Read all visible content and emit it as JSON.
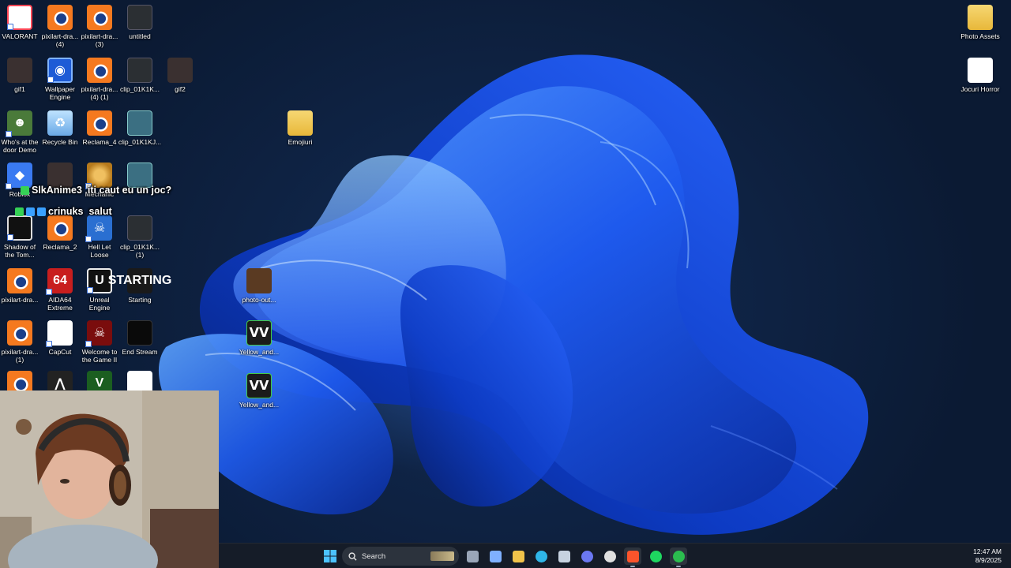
{
  "desktop": {
    "icons_left": [
      {
        "label": "VALORANT",
        "kind": "valorant",
        "glyph": "V"
      },
      {
        "label": "pixilart-dra...\n(4)",
        "kind": "blender",
        "glyph": ""
      },
      {
        "label": "pixilart-dra...\n(3)",
        "kind": "blender",
        "glyph": ""
      },
      {
        "label": "untitled",
        "kind": "dark",
        "glyph": ""
      },
      {
        "label": "gif1",
        "kind": "thumb",
        "glyph": ""
      },
      {
        "label": "Wallpaper\nEngine",
        "kind": "wallpaper",
        "glyph": "◉"
      },
      {
        "label": "pixilart-dra...\n(4) (1)",
        "kind": "blender",
        "glyph": ""
      },
      {
        "label": "clip_01K1K...",
        "kind": "dark",
        "glyph": ""
      },
      {
        "label": "gif2",
        "kind": "thumb",
        "glyph": ""
      },
      {
        "label": "Who's at the\ndoor Demo",
        "kind": "who",
        "glyph": "☻"
      },
      {
        "label": "Recycle Bin",
        "kind": "recycle",
        "glyph": "♻"
      },
      {
        "label": "Reclama_4",
        "kind": "blender",
        "glyph": ""
      },
      {
        "label": "clip_01K1KJ...",
        "kind": "clip",
        "glyph": ""
      },
      {
        "label": "Roblox",
        "kind": "roblox",
        "glyph": "◆"
      },
      {
        "label": "",
        "kind": "thumb",
        "glyph": ""
      },
      {
        "label": "Mechanic",
        "kind": "mech",
        "glyph": ""
      },
      {
        "label": "",
        "kind": "clip",
        "glyph": ""
      },
      {
        "label": "Shadow of\nthe Tom...",
        "kind": "shadow",
        "glyph": ""
      },
      {
        "label": "Reclama_2",
        "kind": "blender",
        "glyph": ""
      },
      {
        "label": "Hell Let\nLoose",
        "kind": "hell",
        "glyph": "☠"
      },
      {
        "label": "clip_01K1K...\n(1)",
        "kind": "dark",
        "glyph": ""
      },
      {
        "label": "pixilart-dra...",
        "kind": "blender",
        "glyph": ""
      },
      {
        "label": "AIDA64\nExtreme",
        "kind": "aida",
        "glyph": "64"
      },
      {
        "label": "Unreal\nEngine",
        "kind": "unreal",
        "glyph": "U"
      },
      {
        "label": "Starting",
        "kind": "starting",
        "glyph": "STARTING"
      },
      {
        "label": "pixilart-dra...\n(1)",
        "kind": "blender",
        "glyph": ""
      },
      {
        "label": "CapCut",
        "kind": "capcut",
        "glyph": "✂"
      },
      {
        "label": "Welcome to\nthe Game II",
        "kind": "skull",
        "glyph": "☠"
      },
      {
        "label": "End Stream",
        "kind": "endstream",
        "glyph": ""
      },
      {
        "label": "",
        "kind": "blender",
        "glyph": ""
      },
      {
        "label": "",
        "kind": "ac",
        "glyph": "⋀"
      },
      {
        "label": "",
        "kind": "gta",
        "glyph": "V"
      },
      {
        "label": "",
        "kind": "xbox",
        "glyph": "✕"
      }
    ],
    "icons_middle": [
      {
        "label": "Emojiuri",
        "kind": "folder",
        "glyph": ""
      },
      {
        "label": "photo-out...",
        "kind": "photo",
        "glyph": ""
      },
      {
        "label": "Yellow_and...",
        "kind": "yellow",
        "glyph": "ᐯᐯ"
      },
      {
        "label": "Yellow_and...",
        "kind": "yellow",
        "glyph": "ᐯᐯ"
      }
    ],
    "icons_right": [
      {
        "label": "Photo Assets",
        "kind": "folder",
        "glyph": ""
      },
      {
        "label": "Jocuri Horror",
        "kind": "doc",
        "glyph": ""
      }
    ]
  },
  "chat": [
    {
      "user": "SlkAnime3",
      "message": "iti caut eu un joc?",
      "user_color": "#ffffff",
      "badges": [
        "#36d156"
      ]
    },
    {
      "user": "crinuks",
      "message": "salut",
      "user_color": "#ffffff",
      "badges": [
        "#36d156",
        "#3aa0ff",
        "#3aa0ff"
      ]
    }
  ],
  "taskbar": {
    "search_placeholder": "Search",
    "pinned": [
      {
        "name": "task-view-icon",
        "color": "#9aa6b8"
      },
      {
        "name": "copilot-icon",
        "color": "#7fb0ff"
      },
      {
        "name": "file-explorer-icon",
        "color": "#f0c34a"
      },
      {
        "name": "edge-icon",
        "color": "#2fb6e8"
      },
      {
        "name": "store-icon",
        "color": "#c7d2e0"
      },
      {
        "name": "discord-icon",
        "color": "#6b78f2"
      },
      {
        "name": "obs-icon",
        "color": "#e0e0e0"
      },
      {
        "name": "brave-icon",
        "color": "#fb542b"
      },
      {
        "name": "spotify-icon",
        "color": "#1ed760"
      },
      {
        "name": "xbox-icon",
        "color": "#2bbd4f"
      }
    ],
    "time": "12:47 AM",
    "date": "8/9/2025"
  }
}
